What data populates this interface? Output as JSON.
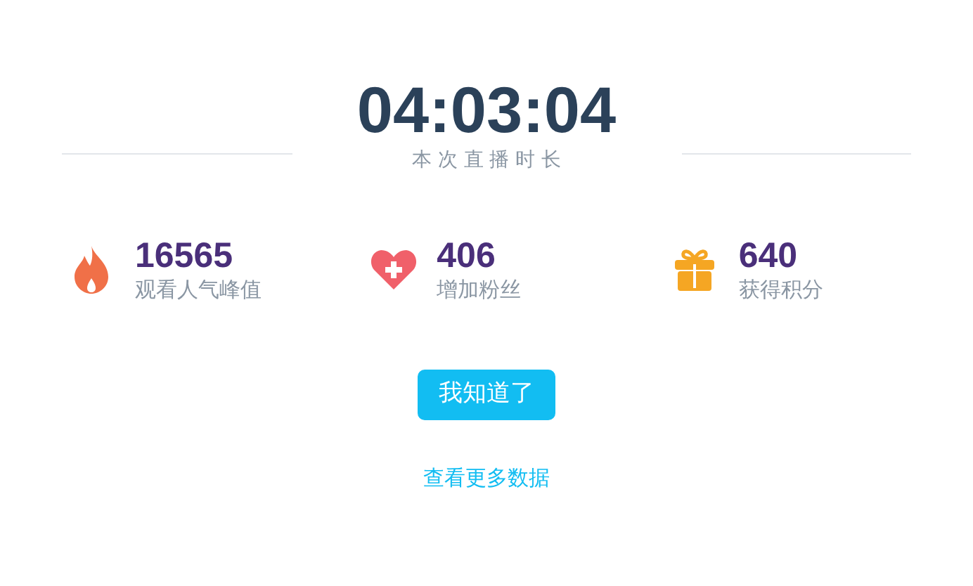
{
  "duration": {
    "value": "04:03:04",
    "label": "本 次 直 播 时 长"
  },
  "stats": [
    {
      "kind": "fire",
      "value": "16565",
      "label": "观看人气峰值"
    },
    {
      "kind": "heart",
      "value": "406",
      "label": "增加粉丝"
    },
    {
      "kind": "gift",
      "value": "640",
      "label": "获得积分"
    }
  ],
  "confirm_button": "我知道了",
  "more_link": "查看更多数据"
}
